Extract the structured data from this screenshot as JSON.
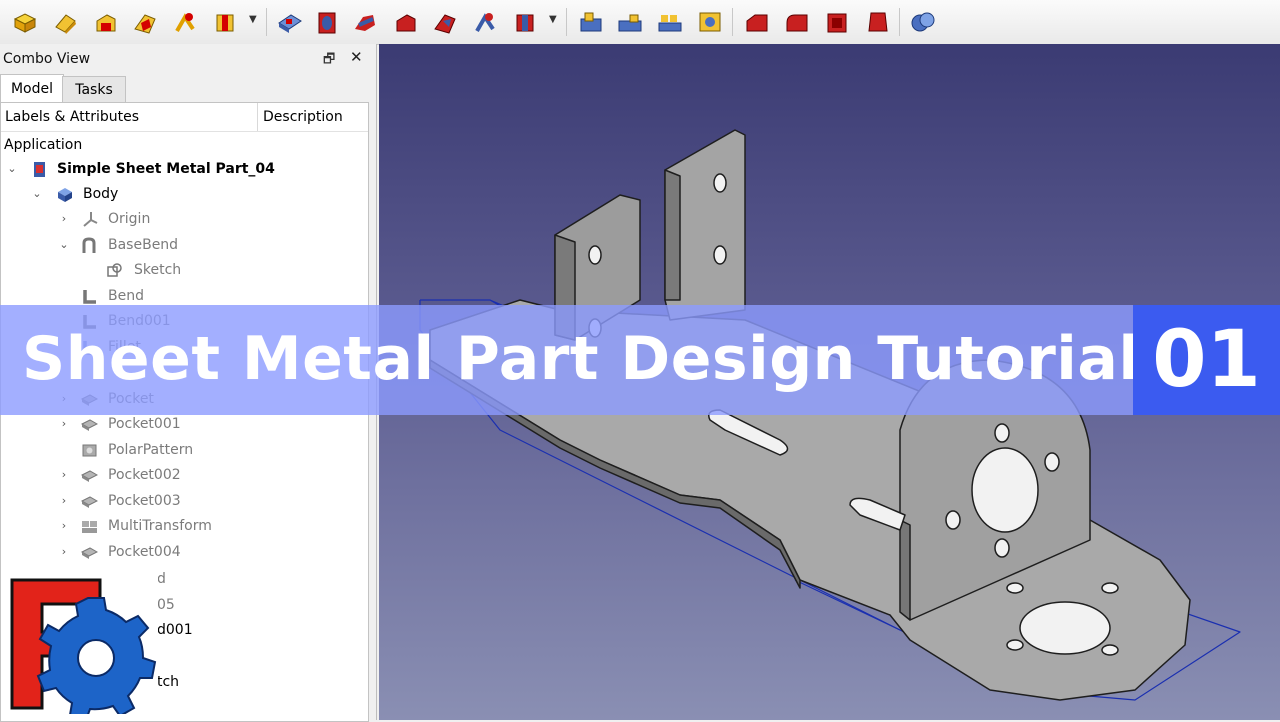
{
  "toolbar": {
    "icons": [
      "box-icon",
      "cylinder-icon",
      "wedge-icon",
      "folding-icon",
      "unfold-icon",
      "face-icon",
      "pocket-icon",
      "hole-icon",
      "relief-icon",
      "corner-icon",
      "tab-icon",
      "sweep-icon",
      "mirror-icon",
      "pattern-a-icon",
      "pattern-b-icon",
      "pattern-c-icon",
      "pattern-d-icon",
      "chamfer-icon",
      "fillet-icon",
      "shell-icon",
      "draft-icon",
      "boolean-icon"
    ]
  },
  "combo": {
    "title": "Combo View",
    "float_icon": "float-icon",
    "close_icon": "close-icon"
  },
  "tabs": {
    "model": "Model",
    "tasks": "Tasks"
  },
  "tree": {
    "header_labels": "Labels & Attributes",
    "header_description": "Description",
    "application": "Application",
    "document": "Simple Sheet Metal Part_04",
    "body": "Body",
    "items": [
      {
        "label": "Origin",
        "chev": "›",
        "icon": "origin-icon"
      },
      {
        "label": "BaseBend",
        "chev": "⌄",
        "icon": "basebend-icon"
      },
      {
        "label": "Sketch",
        "chev": "",
        "icon": "sketch-icon"
      },
      {
        "label": "Bend",
        "chev": "",
        "icon": "bend-icon"
      },
      {
        "label": "Bend001",
        "chev": "",
        "icon": "bend-icon"
      },
      {
        "label": "Fillet",
        "chev": "",
        "icon": "fillet-icon"
      },
      {
        "label": "Pocket",
        "chev": "›",
        "icon": "pocket-icon"
      },
      {
        "label": "Pocket001",
        "chev": "›",
        "icon": "pocket-icon"
      },
      {
        "label": "PolarPattern",
        "chev": "",
        "icon": "polarpattern-icon"
      },
      {
        "label": "Pocket002",
        "chev": "›",
        "icon": "pocket-icon"
      },
      {
        "label": "Pocket003",
        "chev": "›",
        "icon": "pocket-icon"
      },
      {
        "label": "MultiTransform",
        "chev": "›",
        "icon": "multitransform-icon"
      },
      {
        "label": "Pocket004",
        "chev": "›",
        "icon": "pocket-icon"
      }
    ],
    "partial_items": [
      "d",
      "05",
      "d001",
      "tch"
    ]
  },
  "banner": {
    "title": "Sheet Metal Part Design Tutorial",
    "number": "01"
  },
  "colors": {
    "banner_bg": "#8c9bff",
    "badge_bg": "#3b5bf0",
    "viewport_top": "#3b3b73",
    "viewport_bottom": "#8a8fb3"
  }
}
